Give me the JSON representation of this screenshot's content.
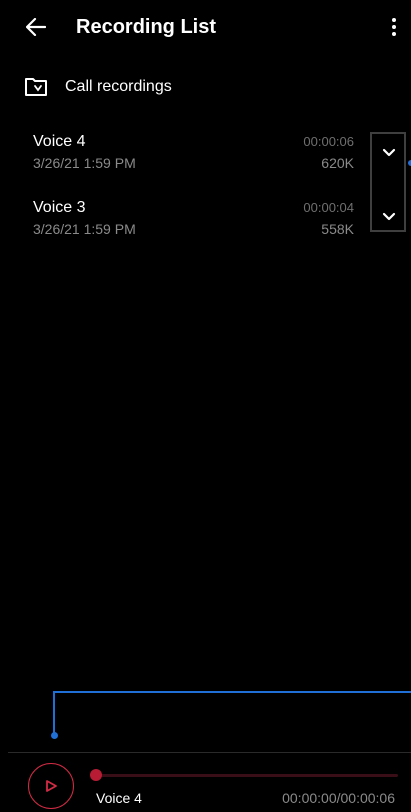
{
  "header": {
    "title": "Recording List",
    "back_icon": "arrow-left-icon",
    "menu_icon": "more-vertical-icon"
  },
  "folder": {
    "icon": "folder-call-icon",
    "label": "Call recordings"
  },
  "recordings": [
    {
      "name": "Voice 4",
      "date": "3/26/21 1:59 PM",
      "duration": "00:00:06",
      "size": "620K"
    },
    {
      "name": "Voice 3",
      "date": "3/26/21 1:59 PM",
      "duration": "00:00:04",
      "size": "558K"
    }
  ],
  "player": {
    "current_name": "Voice 4",
    "time": "00:00:00/00:00:06",
    "progress": 0,
    "accent_color": "#d22b45"
  },
  "colors": {
    "background": "#000000",
    "guide_line": "#1f6fd6"
  }
}
